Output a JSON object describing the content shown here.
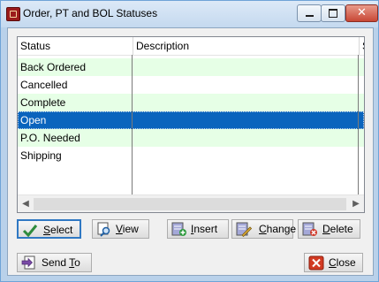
{
  "window": {
    "title": "Order, PT and BOL Statuses"
  },
  "grid": {
    "columns": [
      "Status",
      "Description",
      "S"
    ],
    "rows": [
      {
        "status": "Back Ordered",
        "description": ""
      },
      {
        "status": "Cancelled",
        "description": ""
      },
      {
        "status": "Complete",
        "description": ""
      },
      {
        "status": "Open",
        "description": "",
        "selected": true
      },
      {
        "status": "P.O. Needed",
        "description": ""
      },
      {
        "status": "Shipping",
        "description": ""
      }
    ]
  },
  "buttons": {
    "select": {
      "u": "S",
      "rest": "elect",
      "icon": "checkmark-icon"
    },
    "view": {
      "u": "V",
      "rest": "iew",
      "icon": "magnifier-icon"
    },
    "insert": {
      "u": "I",
      "rest": "nsert",
      "icon": "insert-record-icon"
    },
    "change": {
      "u": "C",
      "rest": "hange",
      "icon": "edit-record-icon"
    },
    "delete": {
      "u": "D",
      "rest": "elete",
      "icon": "delete-record-icon"
    },
    "sendto": {
      "pre": "Send ",
      "u": "T",
      "rest": "o",
      "icon": "send-to-icon"
    },
    "close": {
      "u": "C",
      "rest": "lose",
      "icon": "close-x-icon"
    }
  },
  "colors": {
    "alt_row": "#e6ffe6",
    "selected_row": "#0a64bd",
    "title_bar": "#c4d9ef"
  }
}
